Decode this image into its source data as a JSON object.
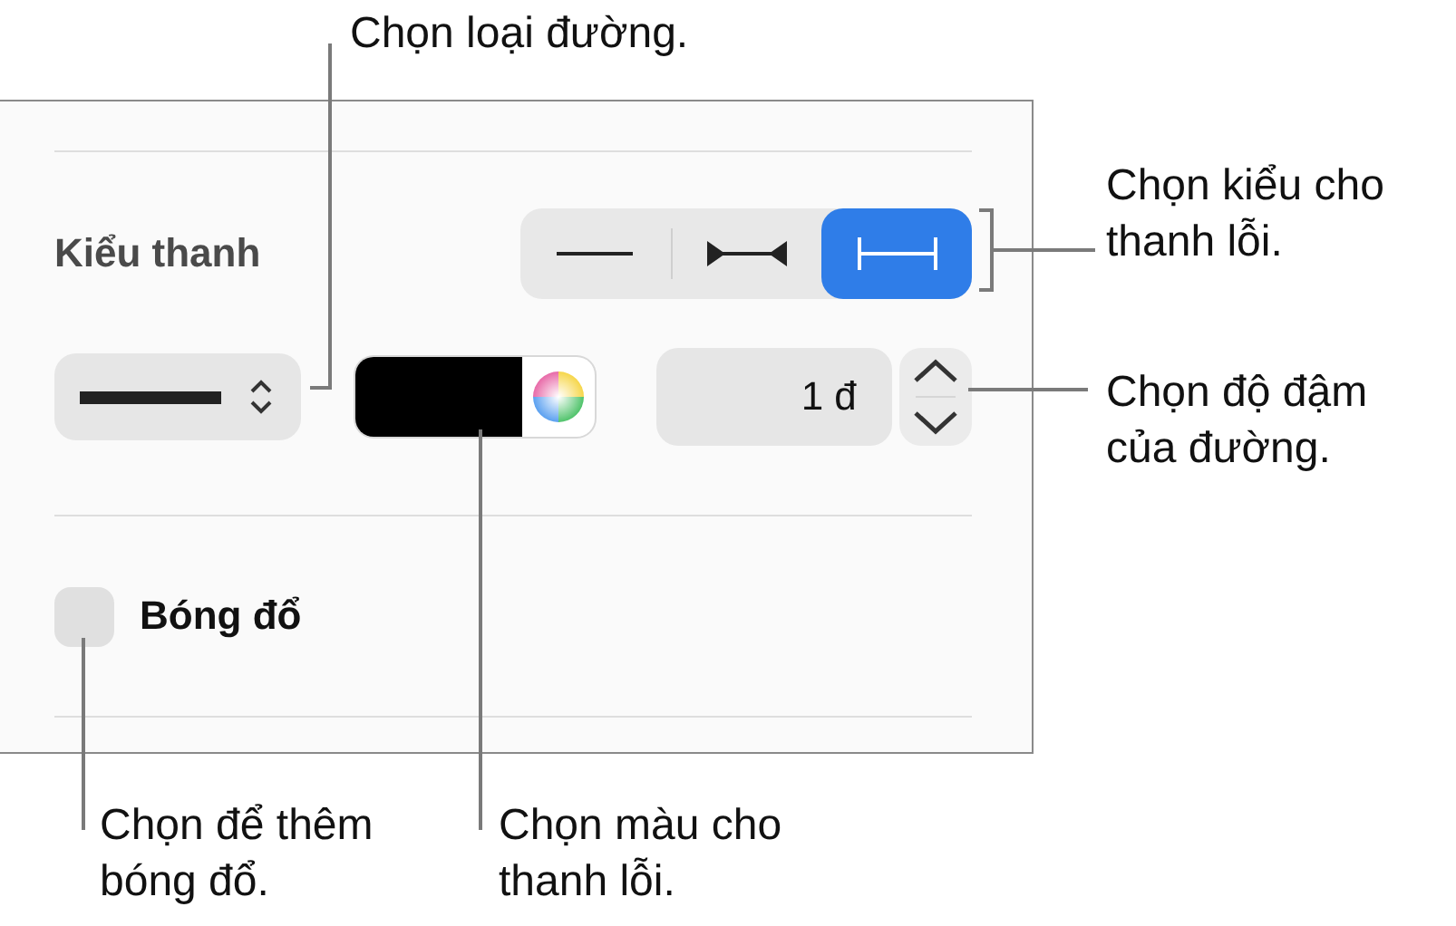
{
  "panel": {
    "bar_style": {
      "label": "Kiểu thanh",
      "segments": [
        {
          "kind": "plain",
          "selected": false
        },
        {
          "kind": "arrows",
          "selected": false
        },
        {
          "kind": "caps",
          "selected": true
        }
      ]
    },
    "line_color": {
      "color": "#000000"
    },
    "line_width": {
      "value": "1 đ"
    },
    "shadow": {
      "label": "Bóng đổ",
      "checked": false
    }
  },
  "callouts": [
    {
      "kind": "line_type",
      "text": "Chọn loại đường."
    },
    {
      "kind": "bar_style",
      "text": "Chọn kiểu cho\nthanh lỗi."
    },
    {
      "kind": "weight",
      "text": "Chọn độ đậm\ncủa đường."
    },
    {
      "kind": "shadow",
      "text": "Chọn để thêm\nbóng đổ."
    },
    {
      "kind": "color",
      "text": "Chọn màu cho\nthanh lỗi."
    }
  ]
}
